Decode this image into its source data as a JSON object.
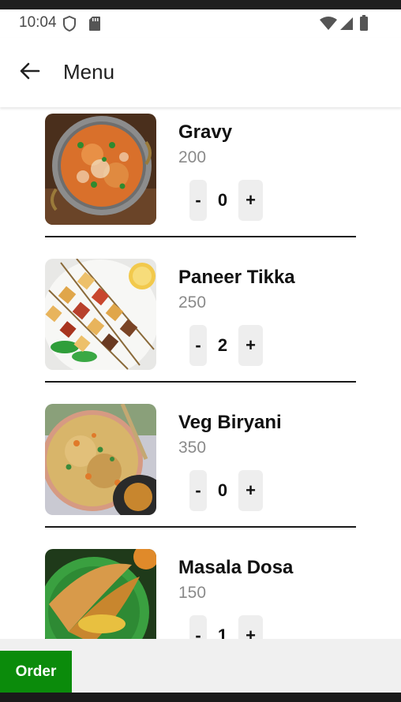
{
  "status_bar": {
    "time": "10:04",
    "left_icons": [
      "shield-icon",
      "sd-card-icon"
    ],
    "right_icons": [
      "wifi-icon",
      "cellular-signal-icon",
      "battery-icon"
    ]
  },
  "app_bar": {
    "title": "Menu",
    "back_icon": "arrow-back-icon"
  },
  "menu": {
    "items": [
      {
        "name": "Gravy",
        "price": "200",
        "minus": "-",
        "qty": "0",
        "plus": "+"
      },
      {
        "name": "Paneer Tikka",
        "price": "250",
        "minus": "-",
        "qty": "2",
        "plus": "+"
      },
      {
        "name": "Veg Biryani",
        "price": "350",
        "minus": "-",
        "qty": "0",
        "plus": "+"
      },
      {
        "name": "Masala Dosa",
        "price": "150",
        "minus": "-",
        "qty": "1",
        "plus": "+"
      }
    ]
  },
  "bottom_bar": {
    "order_label": "Order"
  },
  "colors": {
    "order_button": "#0b8b0b",
    "qty_button_bg": "#eeeeee",
    "price_text": "#8a8a8a",
    "bottom_bar_bg": "#f0f0f0"
  }
}
